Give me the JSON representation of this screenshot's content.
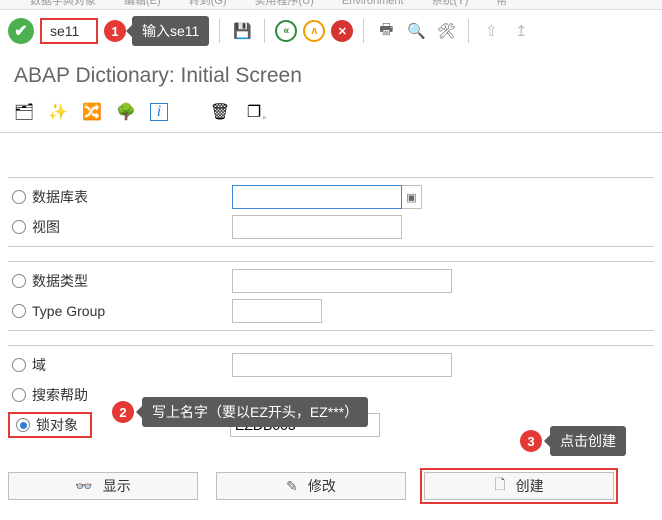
{
  "menu": {
    "items": [
      "数据字典对象",
      "编辑(E)",
      "转到(G)",
      "实用程序(U)",
      "Environment",
      "系统(Y)",
      "帮"
    ]
  },
  "tcode": "se11",
  "hints": {
    "h1": {
      "num": "1",
      "text": "输入se11"
    },
    "h2": {
      "num": "2",
      "text": "写上名字（要以EZ开头，EZ***）"
    },
    "h3": {
      "num": "3",
      "text": "点击创建"
    }
  },
  "title": "ABAP Dictionary: Initial Screen",
  "form": {
    "r1": "数据库表",
    "r2": "视图",
    "r3": "数据类型",
    "r4": "Type Group",
    "r5": "域",
    "r6": "搜索帮助",
    "r7": "锁对象",
    "lock_value": "EZDB003"
  },
  "buttons": {
    "display": "显示",
    "change": "修改",
    "create": "创建"
  }
}
